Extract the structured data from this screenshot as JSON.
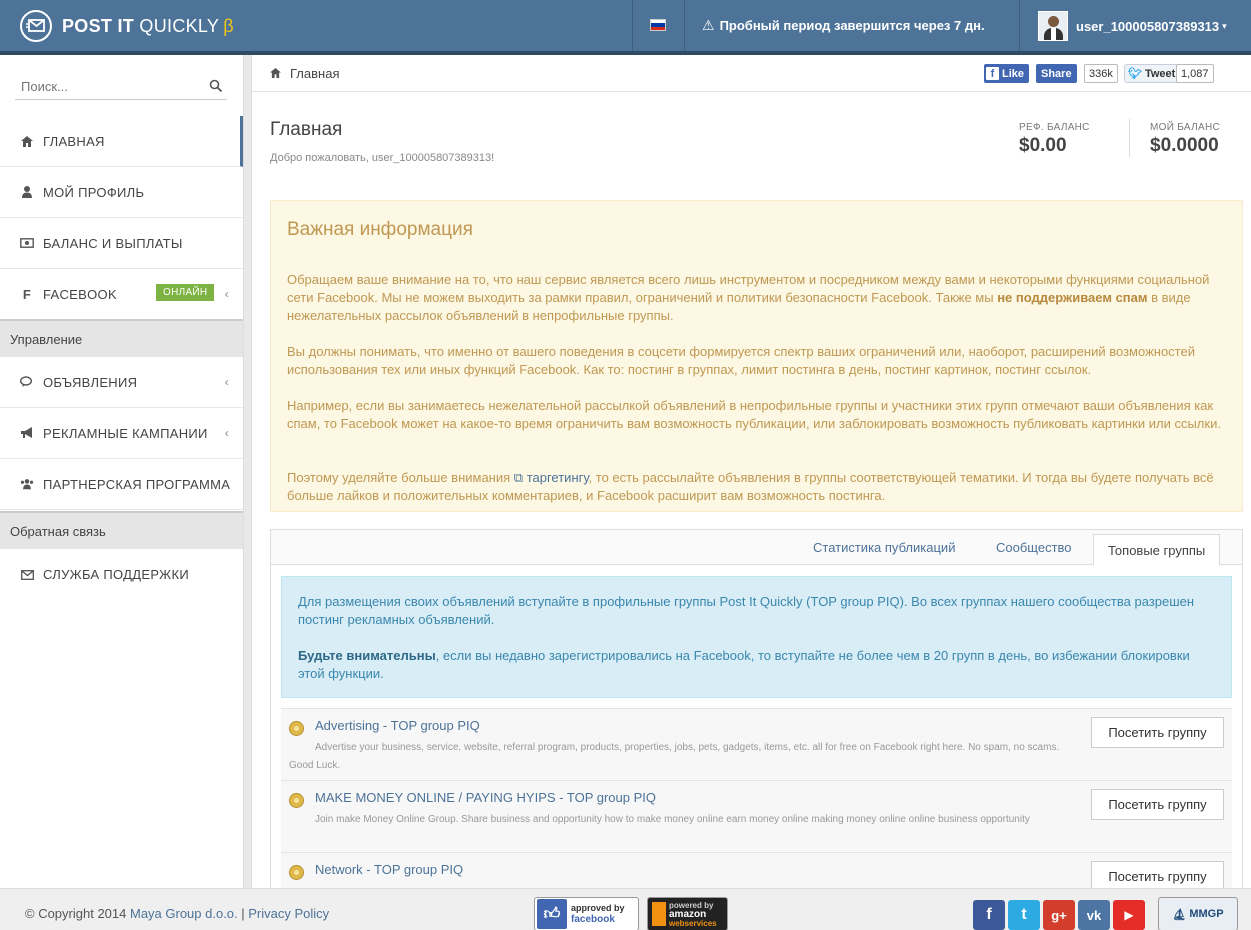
{
  "header": {
    "logo_bold": "POST IT",
    "logo_light": "QUICKLY",
    "logo_beta": "β",
    "trial_text": "Пробный период завершится через 7 дн.",
    "username": "user_100005807389313",
    "flag_colors": [
      "#ffffff",
      "#0039a6",
      "#d52b1e"
    ]
  },
  "sidebar": {
    "search_placeholder": "Поиск...",
    "items": [
      {
        "label": "ГЛАВНАЯ",
        "icon": "home-icon"
      },
      {
        "label": "МОЙ ПРОФИЛЬ",
        "icon": "user-icon"
      },
      {
        "label": "БАЛАНС И ВЫПЛАТЫ",
        "icon": "money-icon"
      },
      {
        "label": "FACEBOOK",
        "icon": "facebook-icon",
        "badge": "ОНЛАЙН"
      }
    ],
    "section_manage": "Управление",
    "manage_items": [
      {
        "label": "ОБЪЯВЛЕНИЯ",
        "icon": "comments-icon"
      },
      {
        "label": "РЕКЛАМНЫЕ КАМПАНИИ",
        "icon": "bullhorn-icon"
      },
      {
        "label": "ПАРТНЕРСКАЯ ПРОГРАММА",
        "icon": "users-icon"
      }
    ],
    "section_feedback": "Обратная связь",
    "feedback_items": [
      {
        "label": "СЛУЖБА ПОДДЕРЖКИ",
        "icon": "envelope-icon"
      }
    ]
  },
  "breadcrumb": {
    "home": "Главная"
  },
  "social_bar": {
    "like": "Like",
    "share": "Share",
    "share_count": "336k",
    "tweet": "Tweet",
    "tweet_count": "1,087"
  },
  "main": {
    "title": "Главная",
    "welcome": "Добро пожаловать, user_100005807389313!",
    "ref_balance_label": "РЕФ. БАЛАНС",
    "ref_balance_value": "$0.00",
    "my_balance_label": "МОЙ БАЛАНС",
    "my_balance_value": "$0.0000"
  },
  "info": {
    "title": "Важная информация",
    "p1_a": "Обращаем ваше внимание на то, что наш сервис является всего лишь инструментом и посредником между вами и некоторыми функциями социальной сети Facebook. Мы не можем выходить за рамки правил, ограничений и политики безопасности Facebook. Также мы ",
    "p1_b": "не поддерживаем спам",
    "p1_c": " в виде нежелательных рассылок объявлений в непрофильные группы.",
    "p2": "Вы должны понимать, что именно от вашего поведения в соцсети формируется спектр ваших ограничений или, наоборот, расширений возможностей использования тех или иных функций Facebook. Как то: постинг в группах, лимит постинга в день, постинг картинок, постинг ссылок.",
    "p3": "Например, если вы занимаетесь нежелательной рассылкой объявлений в непрофильные группы и участники этих групп отмечают ваши объявления как спам, то Facebook может на какое-то время ограничить вам возможность публикации, или заблокировать возможность публиковать картинки или ссылки.",
    "p4_a": "Поэтому уделяйте больше внимания ",
    "p4_link": "таргетингу",
    "p4_b": ", то есть рассылайте объявления в группы соответствующей тематики. И тогда вы будете получать всё больше лайков и положительных комментариев, и Facebook расширит вам возможность постинга."
  },
  "tabs": {
    "stats": "Статистика публикаций",
    "community": "Сообщество",
    "top_groups": "Топовые группы"
  },
  "top_groups": {
    "alert_p1": "Для размещения своих объявлений вступайте в профильные группы Post It Quickly (TOP group PIQ). Во всех группах нашего сообщества разрешен постинг рекламных объявлений.",
    "alert_p2_b": "Будьте внимательны",
    "alert_p2_rest": ", если вы недавно зарегистрировались на Facebook, то вступайте не более чем в 20 групп в день, во избежании блокировки этой функции.",
    "visit_label": "Посетить группу",
    "groups": [
      {
        "title": "Advertising - TOP group PIQ",
        "desc": "Advertise your business, service, website, referral program, products, properties, jobs, pets, gadgets, items, etc. all for free on Facebook right here. No spam, no scams. Good Luck."
      },
      {
        "title": "MAKE MONEY ONLINE / PAYING HYIPS - TOP group PIQ",
        "desc": "Join make Money Online Group. Share business and opportunity how to make money online earn money online making money online online business opportunity"
      },
      {
        "title": "Network - TOP group PIQ",
        "desc": ""
      }
    ]
  },
  "footer": {
    "copy_prefix": "© Copyright 2014 ",
    "company": "Maya Group d.o.o.",
    "separator": " | ",
    "privacy": "Privacy Policy",
    "fb_badge_line1": "approved by",
    "fb_badge_line2": "facebook",
    "aws_line1": "powered by",
    "aws_line2": "amazon",
    "aws_line3": "webservices",
    "mmgp": "MMGP"
  }
}
